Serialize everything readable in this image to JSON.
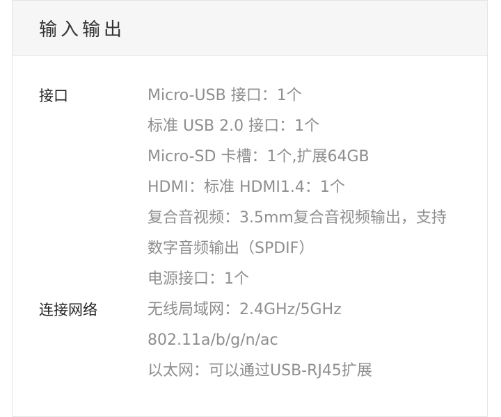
{
  "section": {
    "title": "输入输出"
  },
  "specs": [
    {
      "label": "接口",
      "values": [
        "Micro-USB 接口：1个",
        "标准 USB 2.0 接口：1个",
        "Micro-SD 卡槽：1个,扩展64GB",
        "HDMI：标准 HDMI1.4：1个",
        "复合音视频：3.5mm复合音视频输出，支持",
        "数字音频输出（SPDIF）",
        "电源接口：1个"
      ]
    },
    {
      "label": "连接网络",
      "values": [
        "无线局域网：2.4GHz/5GHz",
        "802.11a/b/g/n/ac",
        "以太网：可以通过USB-RJ45扩展"
      ]
    }
  ]
}
